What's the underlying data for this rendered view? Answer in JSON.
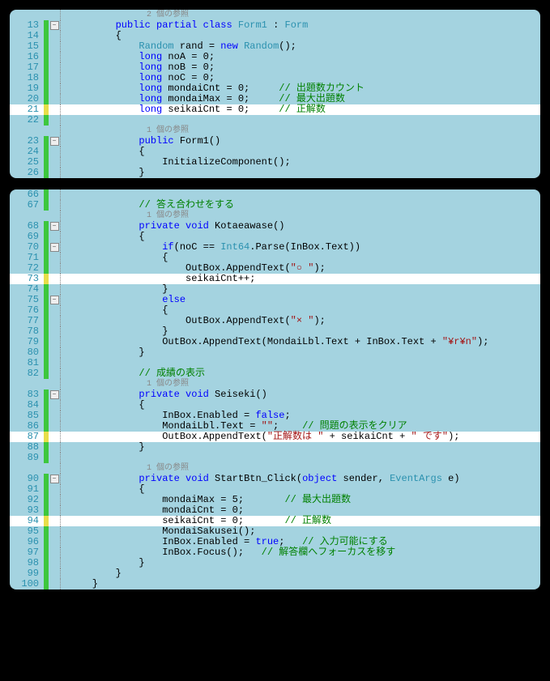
{
  "panels": [
    {
      "lines": [
        {
          "num": "",
          "ch": "",
          "fold": "",
          "hl": false,
          "ref": true,
          "tokens": [
            {
              "t": "                2 個の参照",
              "c": "reference-line"
            }
          ]
        },
        {
          "num": "13",
          "ch": "g",
          "fold": "-",
          "hl": false,
          "tokens": [
            {
              "t": "        ",
              "c": ""
            },
            {
              "t": "public",
              "c": "tok-kw"
            },
            {
              "t": " ",
              "c": ""
            },
            {
              "t": "partial",
              "c": "tok-kw"
            },
            {
              "t": " ",
              "c": ""
            },
            {
              "t": "class",
              "c": "tok-kw"
            },
            {
              "t": " ",
              "c": ""
            },
            {
              "t": "Form1",
              "c": "tok-type"
            },
            {
              "t": " : ",
              "c": ""
            },
            {
              "t": "Form",
              "c": "tok-type"
            }
          ]
        },
        {
          "num": "14",
          "ch": "g",
          "fold": "",
          "hl": false,
          "tokens": [
            {
              "t": "        {",
              "c": ""
            }
          ]
        },
        {
          "num": "15",
          "ch": "g",
          "fold": "",
          "hl": false,
          "tokens": [
            {
              "t": "            ",
              "c": ""
            },
            {
              "t": "Random",
              "c": "tok-type"
            },
            {
              "t": " rand = ",
              "c": ""
            },
            {
              "t": "new",
              "c": "tok-kw"
            },
            {
              "t": " ",
              "c": ""
            },
            {
              "t": "Random",
              "c": "tok-type"
            },
            {
              "t": "();",
              "c": ""
            }
          ]
        },
        {
          "num": "16",
          "ch": "g",
          "fold": "",
          "hl": false,
          "tokens": [
            {
              "t": "            ",
              "c": ""
            },
            {
              "t": "long",
              "c": "tok-kw"
            },
            {
              "t": " noA = 0;",
              "c": ""
            }
          ]
        },
        {
          "num": "17",
          "ch": "g",
          "fold": "",
          "hl": false,
          "tokens": [
            {
              "t": "            ",
              "c": ""
            },
            {
              "t": "long",
              "c": "tok-kw"
            },
            {
              "t": " noB = 0;",
              "c": ""
            }
          ]
        },
        {
          "num": "18",
          "ch": "g",
          "fold": "",
          "hl": false,
          "tokens": [
            {
              "t": "            ",
              "c": ""
            },
            {
              "t": "long",
              "c": "tok-kw"
            },
            {
              "t": " noC = 0;",
              "c": ""
            }
          ]
        },
        {
          "num": "19",
          "ch": "g",
          "fold": "",
          "hl": false,
          "tokens": [
            {
              "t": "            ",
              "c": ""
            },
            {
              "t": "long",
              "c": "tok-kw"
            },
            {
              "t": " mondaiCnt = 0;     ",
              "c": ""
            },
            {
              "t": "// 出題数カウント",
              "c": "tok-com"
            }
          ]
        },
        {
          "num": "20",
          "ch": "g",
          "fold": "",
          "hl": false,
          "tokens": [
            {
              "t": "            ",
              "c": ""
            },
            {
              "t": "long",
              "c": "tok-kw"
            },
            {
              "t": " mondaiMax = 0;     ",
              "c": ""
            },
            {
              "t": "// 最大出題数",
              "c": "tok-com"
            }
          ]
        },
        {
          "num": "21",
          "ch": "y",
          "fold": "",
          "hl": true,
          "tokens": [
            {
              "t": "            ",
              "c": ""
            },
            {
              "t": "long",
              "c": "tok-kw"
            },
            {
              "t": " seikaiCnt = 0;     ",
              "c": ""
            },
            {
              "t": "// 正解数",
              "c": "tok-com"
            }
          ]
        },
        {
          "num": "22",
          "ch": "g",
          "fold": "",
          "hl": false,
          "tokens": [
            {
              "t": "",
              "c": ""
            }
          ]
        },
        {
          "num": "",
          "ch": "",
          "fold": "",
          "hl": false,
          "ref": true,
          "tokens": [
            {
              "t": "                1 個の参照",
              "c": "reference-line"
            }
          ]
        },
        {
          "num": "23",
          "ch": "g",
          "fold": "-",
          "hl": false,
          "tokens": [
            {
              "t": "            ",
              "c": ""
            },
            {
              "t": "public",
              "c": "tok-kw"
            },
            {
              "t": " ",
              "c": ""
            },
            {
              "t": "Form1",
              "c": "tok-ident"
            },
            {
              "t": "()",
              "c": ""
            }
          ]
        },
        {
          "num": "24",
          "ch": "g",
          "fold": "",
          "hl": false,
          "tokens": [
            {
              "t": "            {",
              "c": ""
            }
          ]
        },
        {
          "num": "25",
          "ch": "g",
          "fold": "",
          "hl": false,
          "tokens": [
            {
              "t": "                InitializeComponent();",
              "c": ""
            }
          ]
        },
        {
          "num": "26",
          "ch": "g",
          "fold": "",
          "hl": false,
          "tokens": [
            {
              "t": "            }",
              "c": ""
            }
          ]
        }
      ]
    },
    {
      "lines": [
        {
          "num": "66",
          "ch": "g",
          "fold": "",
          "hl": false,
          "tokens": [
            {
              "t": "",
              "c": ""
            }
          ]
        },
        {
          "num": "67",
          "ch": "g",
          "fold": "",
          "hl": false,
          "tokens": [
            {
              "t": "            ",
              "c": ""
            },
            {
              "t": "// 答え合わせをする",
              "c": "tok-com"
            }
          ]
        },
        {
          "num": "",
          "ch": "",
          "fold": "",
          "hl": false,
          "ref": true,
          "tokens": [
            {
              "t": "                1 個の参照",
              "c": "reference-line"
            }
          ]
        },
        {
          "num": "68",
          "ch": "g",
          "fold": "-",
          "hl": false,
          "tokens": [
            {
              "t": "            ",
              "c": ""
            },
            {
              "t": "private",
              "c": "tok-kw"
            },
            {
              "t": " ",
              "c": ""
            },
            {
              "t": "void",
              "c": "tok-kw"
            },
            {
              "t": " Kotaeawase()",
              "c": ""
            }
          ]
        },
        {
          "num": "69",
          "ch": "g",
          "fold": "",
          "hl": false,
          "tokens": [
            {
              "t": "            {",
              "c": ""
            }
          ]
        },
        {
          "num": "70",
          "ch": "g",
          "fold": "-",
          "hl": false,
          "tokens": [
            {
              "t": "                ",
              "c": ""
            },
            {
              "t": "if",
              "c": "tok-kw"
            },
            {
              "t": "(noC == ",
              "c": ""
            },
            {
              "t": "Int64",
              "c": "tok-type"
            },
            {
              "t": ".Parse(InBox.Text))",
              "c": ""
            }
          ]
        },
        {
          "num": "71",
          "ch": "g",
          "fold": "",
          "hl": false,
          "tokens": [
            {
              "t": "                {",
              "c": ""
            }
          ]
        },
        {
          "num": "72",
          "ch": "g",
          "fold": "",
          "hl": false,
          "tokens": [
            {
              "t": "                    OutBox.AppendText(",
              "c": ""
            },
            {
              "t": "\"○ \"",
              "c": "tok-str"
            },
            {
              "t": ");",
              "c": ""
            }
          ]
        },
        {
          "num": "73",
          "ch": "y",
          "fold": "",
          "hl": true,
          "tokens": [
            {
              "t": "                    seikaiCnt++;",
              "c": ""
            }
          ]
        },
        {
          "num": "74",
          "ch": "g",
          "fold": "",
          "hl": false,
          "tokens": [
            {
              "t": "                }",
              "c": ""
            }
          ]
        },
        {
          "num": "75",
          "ch": "g",
          "fold": "-",
          "hl": false,
          "tokens": [
            {
              "t": "                ",
              "c": ""
            },
            {
              "t": "else",
              "c": "tok-kw"
            }
          ]
        },
        {
          "num": "76",
          "ch": "g",
          "fold": "",
          "hl": false,
          "tokens": [
            {
              "t": "                {",
              "c": ""
            }
          ]
        },
        {
          "num": "77",
          "ch": "g",
          "fold": "",
          "hl": false,
          "tokens": [
            {
              "t": "                    OutBox.AppendText(",
              "c": ""
            },
            {
              "t": "\"× \"",
              "c": "tok-str"
            },
            {
              "t": ");",
              "c": ""
            }
          ]
        },
        {
          "num": "78",
          "ch": "g",
          "fold": "",
          "hl": false,
          "tokens": [
            {
              "t": "                }",
              "c": ""
            }
          ]
        },
        {
          "num": "79",
          "ch": "g",
          "fold": "",
          "hl": false,
          "tokens": [
            {
              "t": "                OutBox.AppendText(MondaiLbl.Text + InBox.Text + ",
              "c": ""
            },
            {
              "t": "\"¥r¥n\"",
              "c": "tok-str"
            },
            {
              "t": ");",
              "c": ""
            }
          ]
        },
        {
          "num": "80",
          "ch": "g",
          "fold": "",
          "hl": false,
          "tokens": [
            {
              "t": "            }",
              "c": ""
            }
          ]
        },
        {
          "num": "81",
          "ch": "g",
          "fold": "",
          "hl": false,
          "tokens": [
            {
              "t": "",
              "c": ""
            }
          ]
        },
        {
          "num": "82",
          "ch": "g",
          "fold": "",
          "hl": false,
          "tokens": [
            {
              "t": "            ",
              "c": ""
            },
            {
              "t": "// 成績の表示",
              "c": "tok-com"
            }
          ]
        },
        {
          "num": "",
          "ch": "",
          "fold": "",
          "hl": false,
          "ref": true,
          "tokens": [
            {
              "t": "                1 個の参照",
              "c": "reference-line"
            }
          ]
        },
        {
          "num": "83",
          "ch": "g",
          "fold": "-",
          "hl": false,
          "tokens": [
            {
              "t": "            ",
              "c": ""
            },
            {
              "t": "private",
              "c": "tok-kw"
            },
            {
              "t": " ",
              "c": ""
            },
            {
              "t": "void",
              "c": "tok-kw"
            },
            {
              "t": " Seiseki()",
              "c": ""
            }
          ]
        },
        {
          "num": "84",
          "ch": "g",
          "fold": "",
          "hl": false,
          "tokens": [
            {
              "t": "            {",
              "c": ""
            }
          ]
        },
        {
          "num": "85",
          "ch": "g",
          "fold": "",
          "hl": false,
          "tokens": [
            {
              "t": "                InBox.Enabled = ",
              "c": ""
            },
            {
              "t": "false",
              "c": "tok-kw"
            },
            {
              "t": ";",
              "c": ""
            }
          ]
        },
        {
          "num": "86",
          "ch": "g",
          "fold": "",
          "hl": false,
          "tokens": [
            {
              "t": "                MondaiLbl.Text = ",
              "c": ""
            },
            {
              "t": "\"\"",
              "c": "tok-str"
            },
            {
              "t": ";    ",
              "c": ""
            },
            {
              "t": "// 問題の表示をクリア",
              "c": "tok-com"
            }
          ]
        },
        {
          "num": "87",
          "ch": "y",
          "fold": "",
          "hl": true,
          "tokens": [
            {
              "t": "                OutBox.AppendText(",
              "c": ""
            },
            {
              "t": "\"正解数は \"",
              "c": "tok-str"
            },
            {
              "t": " + seikaiCnt + ",
              "c": ""
            },
            {
              "t": "\" です\"",
              "c": "tok-str"
            },
            {
              "t": ");",
              "c": ""
            }
          ]
        },
        {
          "num": "88",
          "ch": "g",
          "fold": "",
          "hl": false,
          "tokens": [
            {
              "t": "            }",
              "c": ""
            }
          ]
        },
        {
          "num": "89",
          "ch": "g",
          "fold": "",
          "hl": false,
          "tokens": [
            {
              "t": "",
              "c": ""
            }
          ]
        },
        {
          "num": "",
          "ch": "",
          "fold": "",
          "hl": false,
          "ref": true,
          "tokens": [
            {
              "t": "                1 個の参照",
              "c": "reference-line"
            }
          ]
        },
        {
          "num": "90",
          "ch": "g",
          "fold": "-",
          "hl": false,
          "tokens": [
            {
              "t": "            ",
              "c": ""
            },
            {
              "t": "private",
              "c": "tok-kw"
            },
            {
              "t": " ",
              "c": ""
            },
            {
              "t": "void",
              "c": "tok-kw"
            },
            {
              "t": " StartBtn_Click(",
              "c": ""
            },
            {
              "t": "object",
              "c": "tok-kw"
            },
            {
              "t": " sender, ",
              "c": ""
            },
            {
              "t": "EventArgs",
              "c": "tok-type"
            },
            {
              "t": " e)",
              "c": ""
            }
          ]
        },
        {
          "num": "91",
          "ch": "g",
          "fold": "",
          "hl": false,
          "tokens": [
            {
              "t": "            {",
              "c": ""
            }
          ]
        },
        {
          "num": "92",
          "ch": "g",
          "fold": "",
          "hl": false,
          "tokens": [
            {
              "t": "                mondaiMax = 5;       ",
              "c": ""
            },
            {
              "t": "// 最大出題数",
              "c": "tok-com"
            }
          ]
        },
        {
          "num": "93",
          "ch": "g",
          "fold": "",
          "hl": false,
          "tokens": [
            {
              "t": "                mondaiCnt = 0;",
              "c": ""
            }
          ]
        },
        {
          "num": "94",
          "ch": "y",
          "fold": "",
          "hl": true,
          "tokens": [
            {
              "t": "                seikaiCnt = 0;       ",
              "c": ""
            },
            {
              "t": "// 正解数",
              "c": "tok-com"
            }
          ]
        },
        {
          "num": "95",
          "ch": "g",
          "fold": "",
          "hl": false,
          "tokens": [
            {
              "t": "                MondaiSakusei();",
              "c": ""
            }
          ]
        },
        {
          "num": "96",
          "ch": "g",
          "fold": "",
          "hl": false,
          "tokens": [
            {
              "t": "                InBox.Enabled = ",
              "c": ""
            },
            {
              "t": "true",
              "c": "tok-kw"
            },
            {
              "t": ";   ",
              "c": ""
            },
            {
              "t": "// 入力可能にする",
              "c": "tok-com"
            }
          ]
        },
        {
          "num": "97",
          "ch": "g",
          "fold": "",
          "hl": false,
          "tokens": [
            {
              "t": "                InBox.Focus();   ",
              "c": ""
            },
            {
              "t": "// 解答欄へフォーカスを移す",
              "c": "tok-com"
            }
          ]
        },
        {
          "num": "98",
          "ch": "g",
          "fold": "",
          "hl": false,
          "tokens": [
            {
              "t": "            }",
              "c": ""
            }
          ]
        },
        {
          "num": "99",
          "ch": "g",
          "fold": "",
          "hl": false,
          "tokens": [
            {
              "t": "        }",
              "c": ""
            }
          ]
        },
        {
          "num": "100",
          "ch": "g",
          "fold": "",
          "hl": false,
          "tokens": [
            {
              "t": "    }",
              "c": ""
            }
          ]
        }
      ]
    }
  ]
}
